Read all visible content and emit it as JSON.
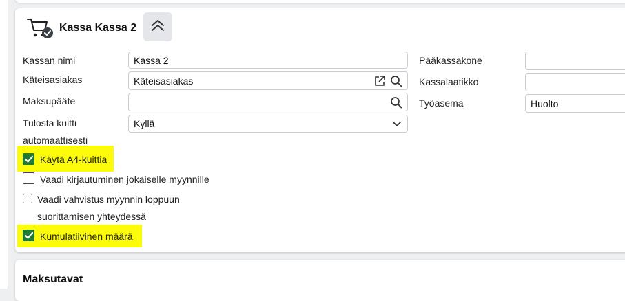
{
  "header": {
    "title": "Kassa Kassa 2"
  },
  "labels": {
    "kassan_nimi": "Kassan nimi",
    "kateisasiakas": "Käteisasiakas",
    "maksupaate": "Maksupääte",
    "tulosta_kuitti_1": "Tulosta kuitti",
    "tulosta_kuitti_2": "automaattisesti",
    "paakassakone": "Pääkassakone",
    "kassalaatikko": "Kassalaatikko",
    "tyoasema": "Työasema"
  },
  "fields": {
    "kassan_nimi": "Kassa 2",
    "kateisasiakas": "Käteisasiakas",
    "maksupaate": "",
    "tulosta_kuitti": "Kyllä",
    "paakassakone": "",
    "kassalaatikko": "",
    "tyoasema": "Huolto"
  },
  "checkboxes": {
    "a4": {
      "label": "Käytä A4-kuittia",
      "checked": true
    },
    "kirjautuminen": {
      "label": "Vaadi kirjautuminen jokaiselle myynnille",
      "checked": false
    },
    "vahvistus_1": "Vaadi vahvistus myynnin loppuun",
    "vahvistus_2": "suorittamisen yhteydessä",
    "kumulatiivinen": {
      "label": "Kumulatiivinen määrä",
      "checked": true
    }
  },
  "section2": {
    "title": "Maksutavat"
  },
  "colors": {
    "highlight": "#fbfb0a",
    "checkbox_checked": "#1f7a34"
  }
}
